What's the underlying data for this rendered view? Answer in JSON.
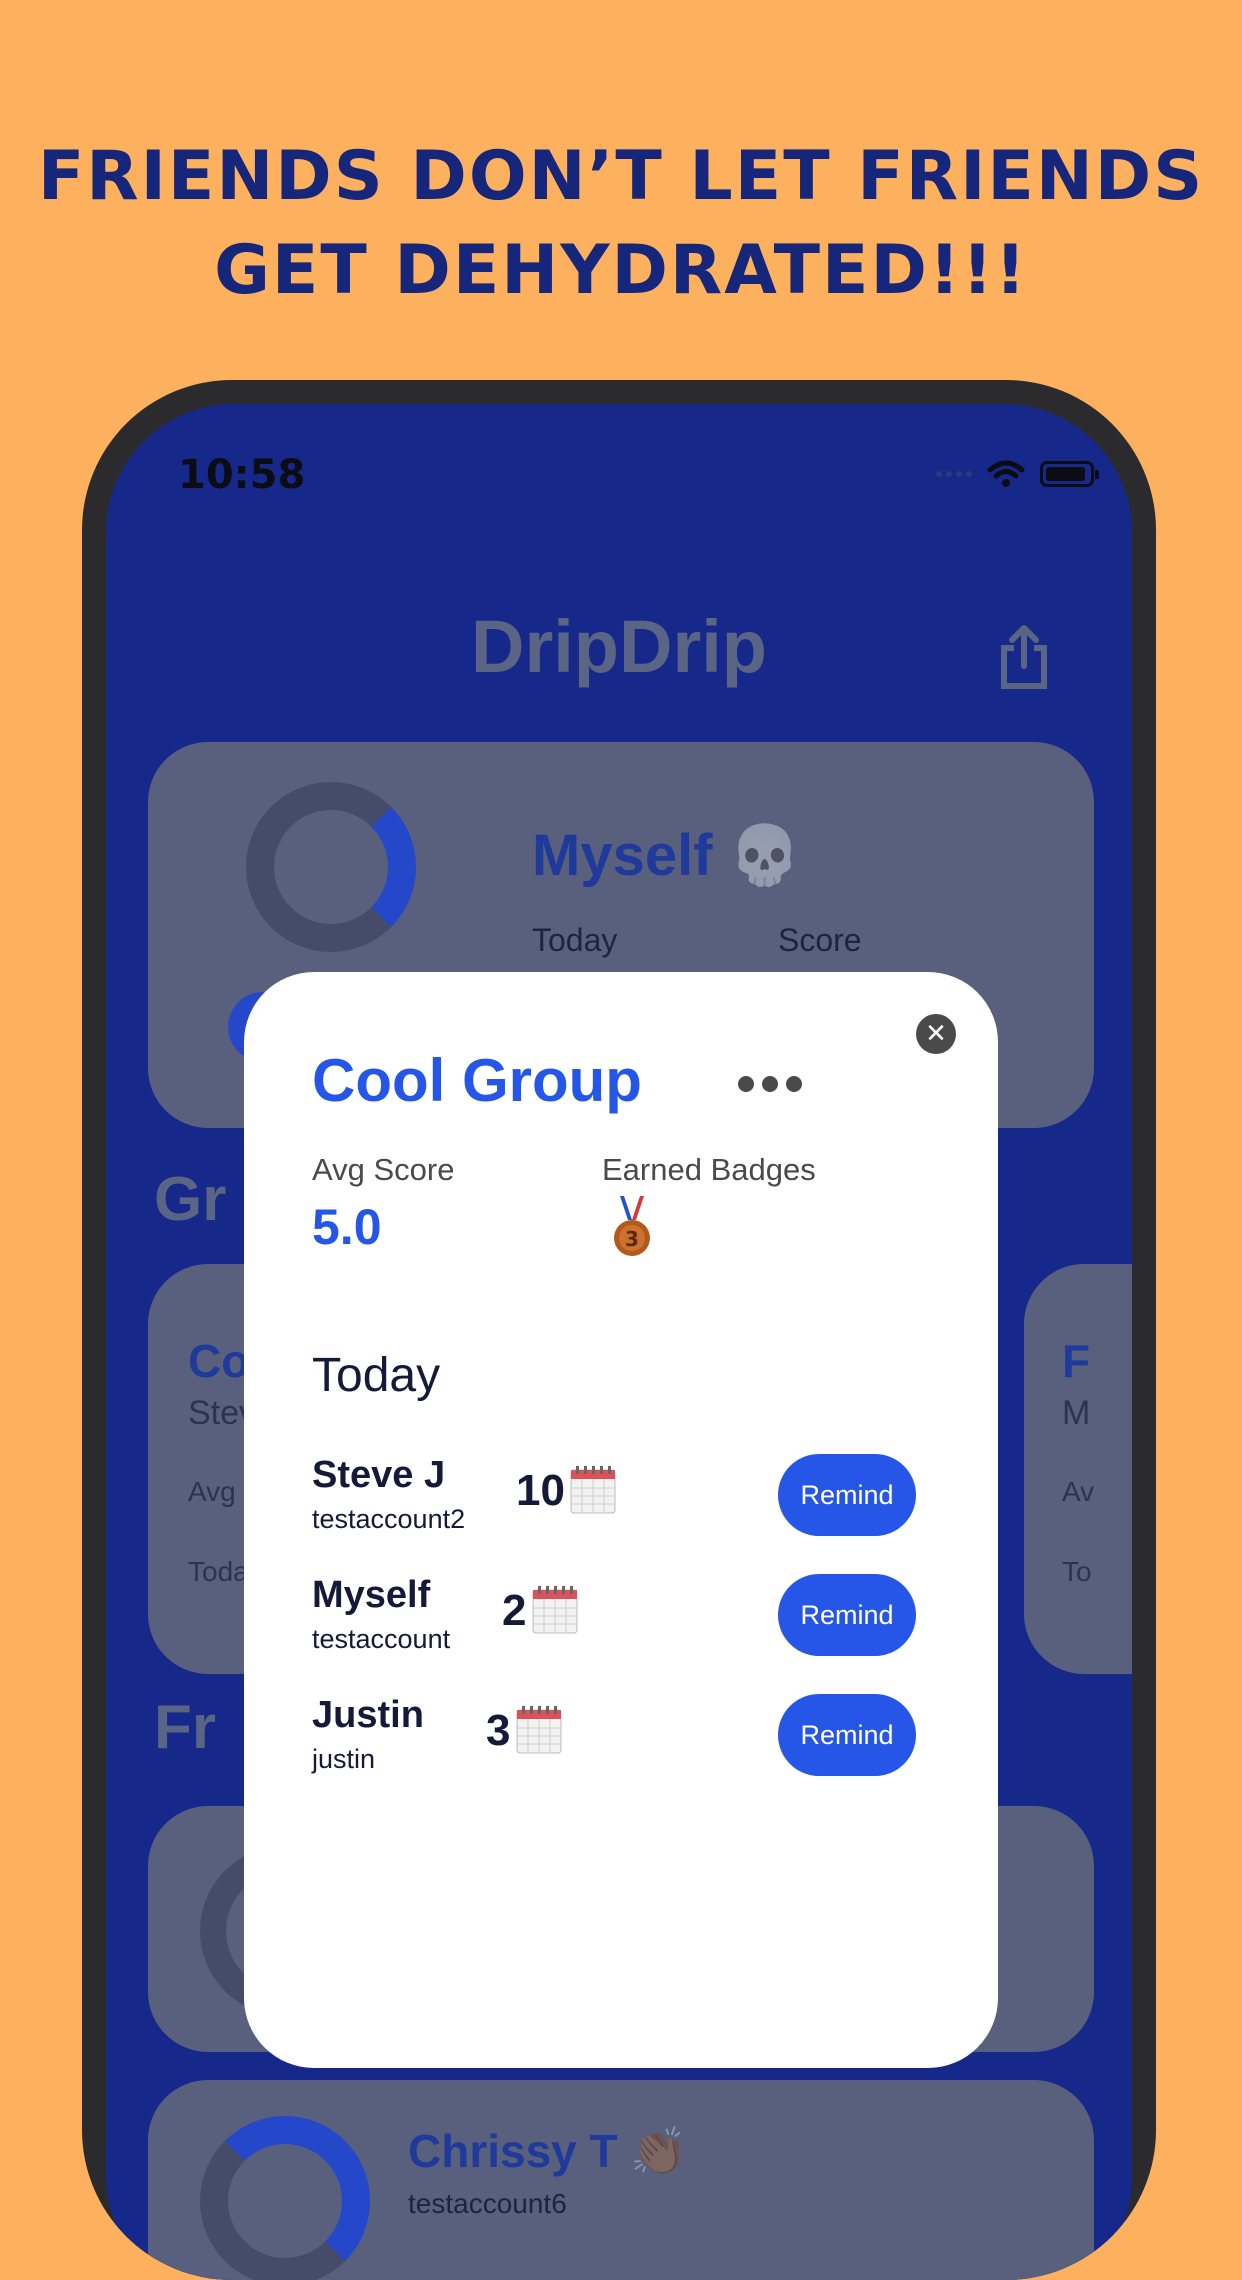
{
  "headline": {
    "line1": "FRIENDS DON’T LET FRIENDS",
    "line2": "GET DEHYDRATED!!!"
  },
  "status_bar": {
    "time": "10:58"
  },
  "app": {
    "title": "DripDrip",
    "share_icon": "share-icon"
  },
  "my_card": {
    "name": "Myself",
    "emoji": "💀",
    "today_label": "Today",
    "score_label": "Score"
  },
  "sections": {
    "groups_partial": "Gr",
    "friends_partial": "Fr"
  },
  "group_card_left": {
    "title_partial": "Co",
    "sub_partial": "Stev",
    "avg_partial": "Avg",
    "today_partial": "Toda"
  },
  "group_card_right": {
    "title_partial": "F",
    "sub_partial": "M",
    "avg_partial": "Av",
    "today_partial": "To"
  },
  "friend_card_2": {
    "name": "Chrissy T",
    "emoji": "👏🏾",
    "username": "testaccount6"
  },
  "modal": {
    "title": "Cool Group",
    "avg_score_label": "Avg Score",
    "avg_score_value": "5.0",
    "badges_label": "Earned Badges",
    "badge_icon": "bronze-medal-icon",
    "today_heading": "Today",
    "members": [
      {
        "name": "Steve J",
        "username": "testaccount2",
        "count": "10",
        "button": "Remind"
      },
      {
        "name": "Myself",
        "username": "testaccount",
        "count": "2",
        "button": "Remind"
      },
      {
        "name": "Justin",
        "username": "justin",
        "count": "3",
        "button": "Remind"
      }
    ]
  },
  "colors": {
    "background": "#FDB15E",
    "headline": "#16267A",
    "screen": "#16288A",
    "accent": "#2556E8",
    "card": "#58607E"
  }
}
